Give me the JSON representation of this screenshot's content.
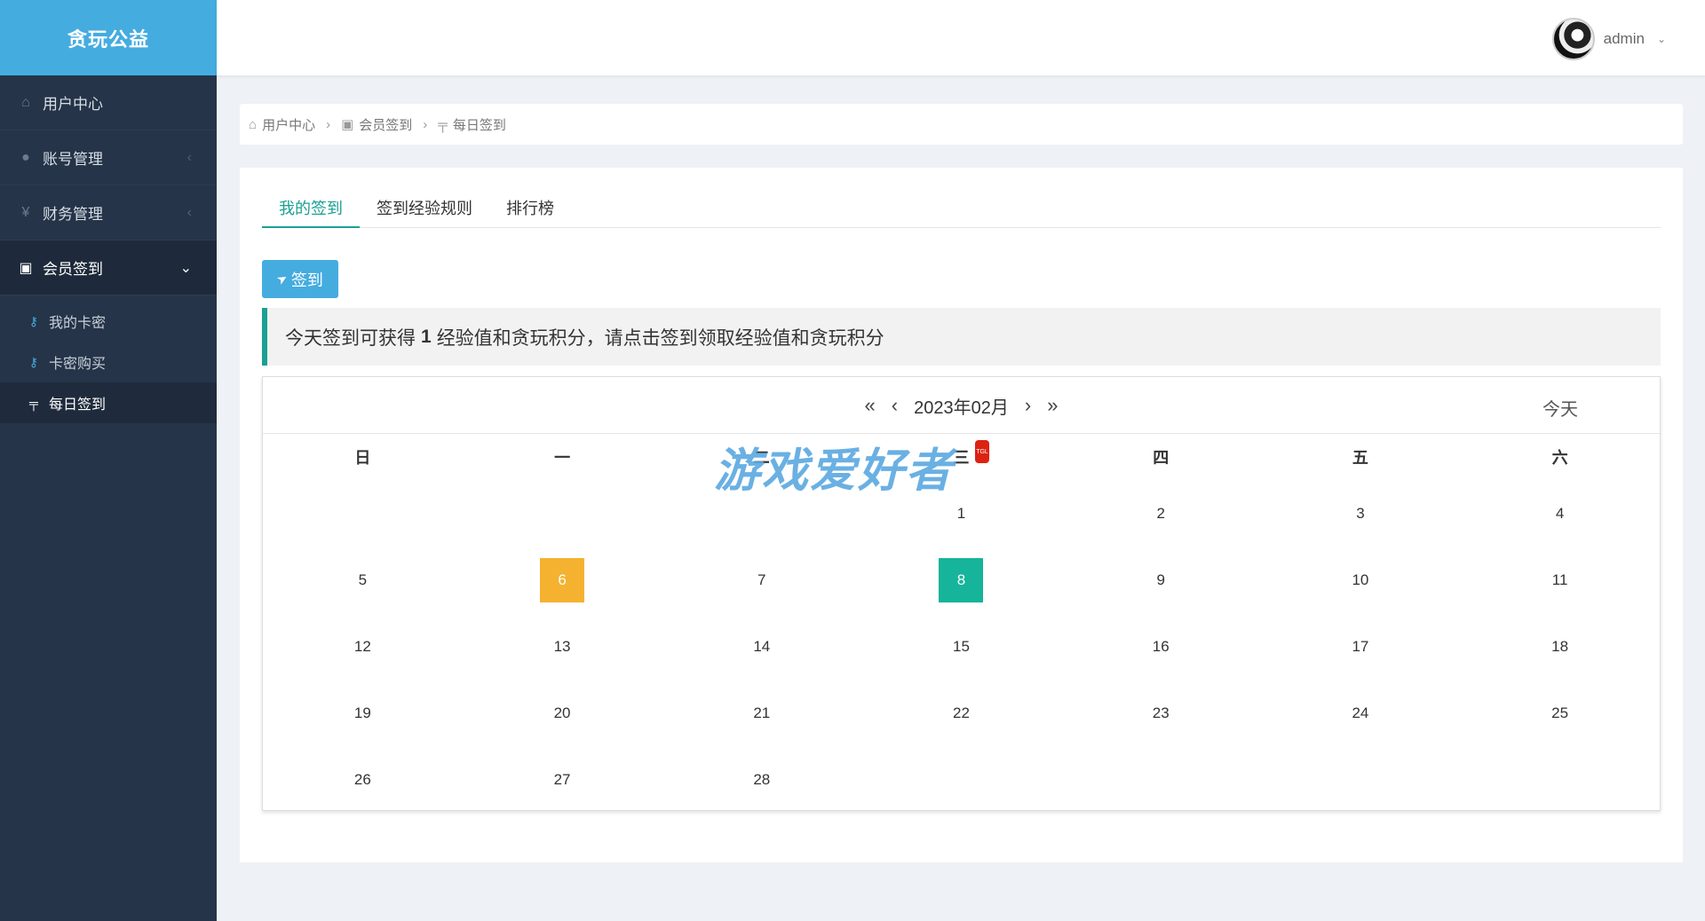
{
  "app": {
    "title": "贪玩公益"
  },
  "sidebar": {
    "items": [
      {
        "label": "用户中心",
        "icon": "home-icon"
      },
      {
        "label": "账号管理",
        "icon": "user-icon"
      },
      {
        "label": "财务管理",
        "icon": "yen-icon"
      },
      {
        "label": "会员签到",
        "icon": "calendar-check-icon"
      }
    ],
    "submenu": [
      {
        "label": "我的卡密",
        "icon": "key-icon"
      },
      {
        "label": "卡密购买",
        "icon": "key-icon"
      },
      {
        "label": "每日签到",
        "icon": "signpost-icon"
      }
    ]
  },
  "header": {
    "username": "admin"
  },
  "breadcrumb": [
    "用户中心",
    "会员签到",
    "每日签到"
  ],
  "tabs": [
    "我的签到",
    "签到经验规则",
    "排行榜"
  ],
  "sign_button": "签到",
  "notice": {
    "before": "今天签到可获得",
    "value": "1",
    "after": "经验值和贪玩积分，请点击签到领取经验值和贪玩积分"
  },
  "calendar": {
    "month_label": "2023年02月",
    "today_label": "今天",
    "weekdays": [
      "日",
      "一",
      "二",
      "三",
      "四",
      "五",
      "六"
    ],
    "leading_blanks": 3,
    "days": [
      "1",
      "2",
      "3",
      "4",
      "5",
      "6",
      "7",
      "8",
      "9",
      "10",
      "11",
      "12",
      "13",
      "14",
      "15",
      "16",
      "17",
      "18",
      "19",
      "20",
      "21",
      "22",
      "23",
      "24",
      "25",
      "26",
      "27",
      "28"
    ],
    "signed_day": "6",
    "today_day": "8",
    "signed_color": "#f4b230",
    "today_color": "#16b49a"
  },
  "watermark": {
    "text": "游戏爱好者",
    "seal": "TGL"
  }
}
